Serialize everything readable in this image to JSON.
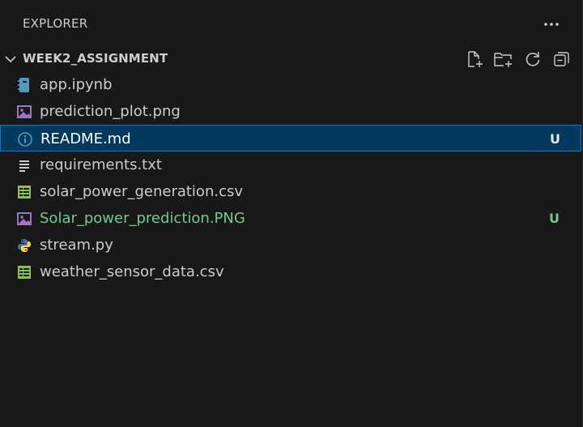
{
  "header": {
    "title": "EXPLORER",
    "more_icon": "ellipsis-icon"
  },
  "section": {
    "title": "WEEK2_ASSIGNMENT",
    "expanded": true,
    "actions": [
      {
        "icon": "new-file-icon"
      },
      {
        "icon": "new-folder-icon"
      },
      {
        "icon": "refresh-icon"
      },
      {
        "icon": "collapse-all-icon"
      }
    ]
  },
  "files": [
    {
      "name": "app.ipynb",
      "icon": "notebook-icon",
      "badge": "",
      "status": ""
    },
    {
      "name": "prediction_plot.png",
      "icon": "image-icon",
      "badge": "",
      "status": ""
    },
    {
      "name": "README.md",
      "icon": "info-icon",
      "badge": "U",
      "status": "selected"
    },
    {
      "name": "requirements.txt",
      "icon": "text-lines-icon",
      "badge": "",
      "status": ""
    },
    {
      "name": "solar_power_generation.csv",
      "icon": "table-icon",
      "badge": "",
      "status": ""
    },
    {
      "name": "Solar_power_prediction.PNG",
      "icon": "image-icon",
      "badge": "U",
      "status": "untracked"
    },
    {
      "name": "stream.py",
      "icon": "python-icon",
      "badge": "",
      "status": ""
    },
    {
      "name": "weather_sensor_data.csv",
      "icon": "table-icon",
      "badge": "",
      "status": ""
    }
  ],
  "colors": {
    "background": "#181818",
    "selected_bg": "#04395e",
    "selected_border": "#0078d4",
    "untracked": "#73c991",
    "image_icon": "#a074c4",
    "notebook_icon": "#519aba",
    "csv_icon": "#8dc149",
    "python_blue": "#3572a5",
    "python_yellow": "#ffd43b"
  }
}
